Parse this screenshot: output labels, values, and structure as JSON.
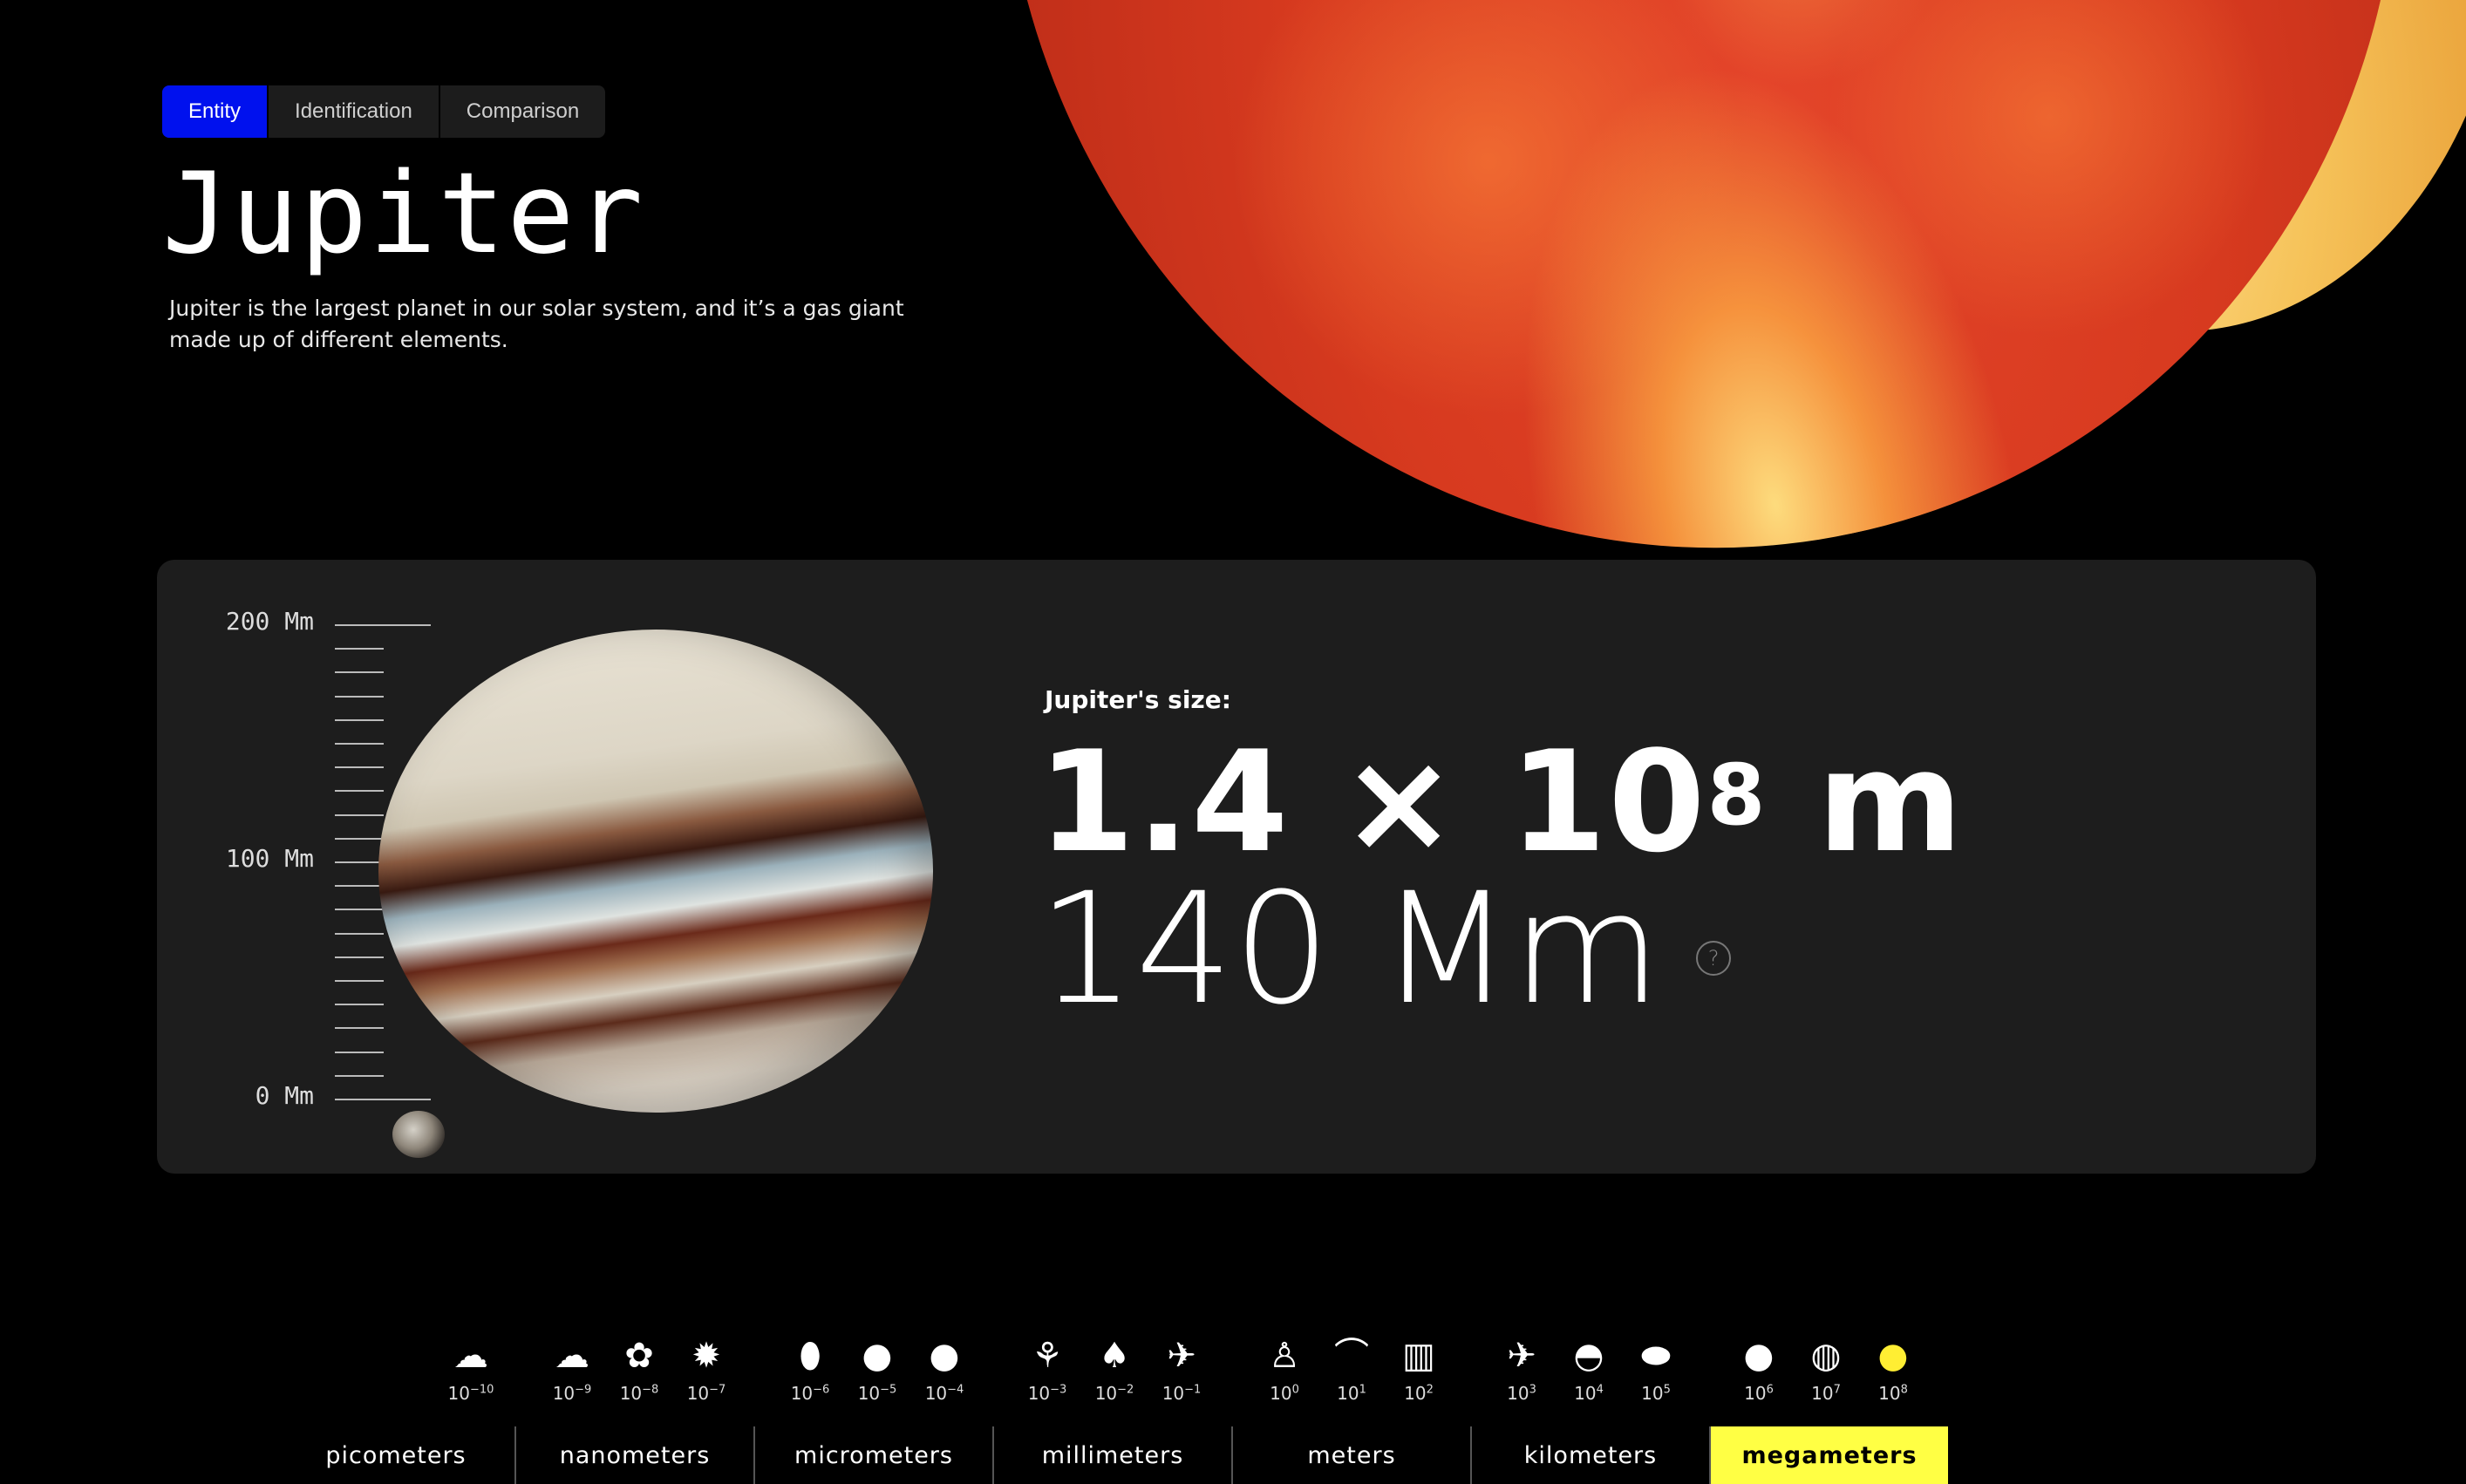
{
  "tabs": [
    "Entity",
    "Identification",
    "Comparison"
  ],
  "entity": {
    "name": "Jupiter",
    "description": "Jupiter is the largest planet in our solar system, and it’s a gas giant made up of different elements."
  },
  "ruler": {
    "top": "200 Mm",
    "mid": "100 Mm",
    "bottom": "0 Mm"
  },
  "size": {
    "label": "Jupiter's size:",
    "mantissa": "1.4 × 10",
    "exponent": "8",
    "unit": "m",
    "plain": "140 Mm",
    "help": "?"
  },
  "scale_powers": [
    "-10",
    "-9",
    "-8",
    "-7",
    "-6",
    "-5",
    "-4",
    "-3",
    "-2",
    "-1",
    "0",
    "1",
    "2",
    "3",
    "4",
    "5",
    "6",
    "7",
    "8"
  ],
  "scale_icons": [
    "cloud-glyph",
    "cloud-glyph",
    "virus-glyph",
    "spiky-cell-glyph",
    "bacterium-glyph",
    "cell-glyph",
    "cell-glyph",
    "ant-glyph",
    "acorn-glyph",
    "hummingbird-glyph",
    "person-glyph",
    "whale-glyph",
    "building-glyph",
    "plane-glyph",
    "island-glyph",
    "disc-glyph",
    "moon-glyph",
    "earth-glyph",
    "jupiter-glyph"
  ],
  "units": [
    "picometers",
    "nanometers",
    "micrometers",
    "millimeters",
    "meters",
    "kilometers",
    "megameters"
  ],
  "active_unit": "megameters",
  "active_power": "8"
}
